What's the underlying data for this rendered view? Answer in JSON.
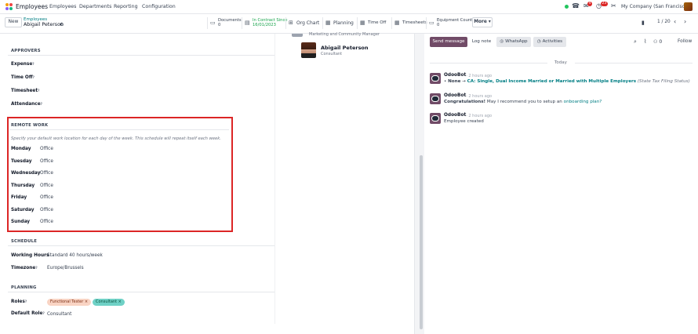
{
  "navbar": {
    "app_name": "Employees",
    "menus": [
      "Employees",
      "Departments",
      "Reporting",
      "Configuration"
    ],
    "badges": {
      "activity": "4",
      "messages": "23"
    },
    "company": "My Company (San Francisco)"
  },
  "control_panel": {
    "new_label": "New",
    "breadcrumb_parent": "Employees",
    "breadcrumb_current": "Abigail Peterson",
    "smart_buttons": [
      {
        "label": "Documents",
        "value": "0",
        "icon": "file-icon"
      },
      {
        "label": "In Contract Since",
        "value": "16/01/2023",
        "icon": "contract-icon"
      },
      {
        "label": "Org Chart",
        "value": "",
        "icon": "org-chart-icon"
      },
      {
        "label": "Planning",
        "value": "",
        "icon": "calendar-icon"
      },
      {
        "label": "Time Off",
        "value": "",
        "icon": "calendar-icon"
      },
      {
        "label": "Timesheets",
        "value": "",
        "icon": "calendar-icon"
      },
      {
        "label": "Equipment Count",
        "value": "0",
        "icon": "laptop-icon"
      }
    ],
    "more_label": "More",
    "pager": "1 / 20"
  },
  "form": {
    "manager_text": "Marketing and Community Manager",
    "coach": {
      "name": "Abigail Peterson",
      "role": "Consultant"
    },
    "approvers": {
      "title": "APPROVERS",
      "fields": [
        "Expense",
        "Time Off",
        "Timesheet",
        "Attendance"
      ]
    },
    "remote_work": {
      "title": "REMOTE WORK",
      "hint": "Specify your default work location for each day of the week. This schedule will repeat itself each week.",
      "days": [
        {
          "day": "Monday",
          "location": "Office"
        },
        {
          "day": "Tuesday",
          "location": "Office"
        },
        {
          "day": "Wednesday",
          "location": "Office"
        },
        {
          "day": "Thursday",
          "location": "Office"
        },
        {
          "day": "Friday",
          "location": "Office"
        },
        {
          "day": "Saturday",
          "location": "Office"
        },
        {
          "day": "Sunday",
          "location": "Office"
        }
      ]
    },
    "schedule": {
      "title": "SCHEDULE",
      "working_hours_label": "Working Hours",
      "working_hours": "Standard 40 hours/week",
      "timezone_label": "Timezone",
      "timezone": "Europe/Brussels"
    },
    "planning": {
      "title": "PLANNING",
      "roles_label": "Roles",
      "roles": [
        {
          "name": "Functional Tester",
          "color": "#f9d4c4"
        },
        {
          "name": "Consultant",
          "color": "#6fd1c6"
        }
      ],
      "default_role_label": "Default Role",
      "default_role": "Consultant"
    }
  },
  "chatter": {
    "send_message": "Send message",
    "log_note": "Log note",
    "whatsapp": "WhatsApp",
    "activities": "Activities",
    "followers_count": "0",
    "follow": "Follow",
    "today": "Today",
    "messages": [
      {
        "author": "OdooBot",
        "time": "- 2 hours ago",
        "parts": [
          "None",
          "→",
          "CA: Single, Dual Income Married or Married with Multiple Employers",
          "(State Tax Filing Status)"
        ]
      },
      {
        "author": "OdooBot",
        "time": "- 2 hours ago",
        "parts": [
          "Congratulations!",
          "May I recommend you to setup an",
          "onboarding plan?"
        ]
      },
      {
        "author": "OdooBot",
        "time": "- 2 hours ago",
        "parts": [
          "Employee created"
        ]
      }
    ]
  }
}
